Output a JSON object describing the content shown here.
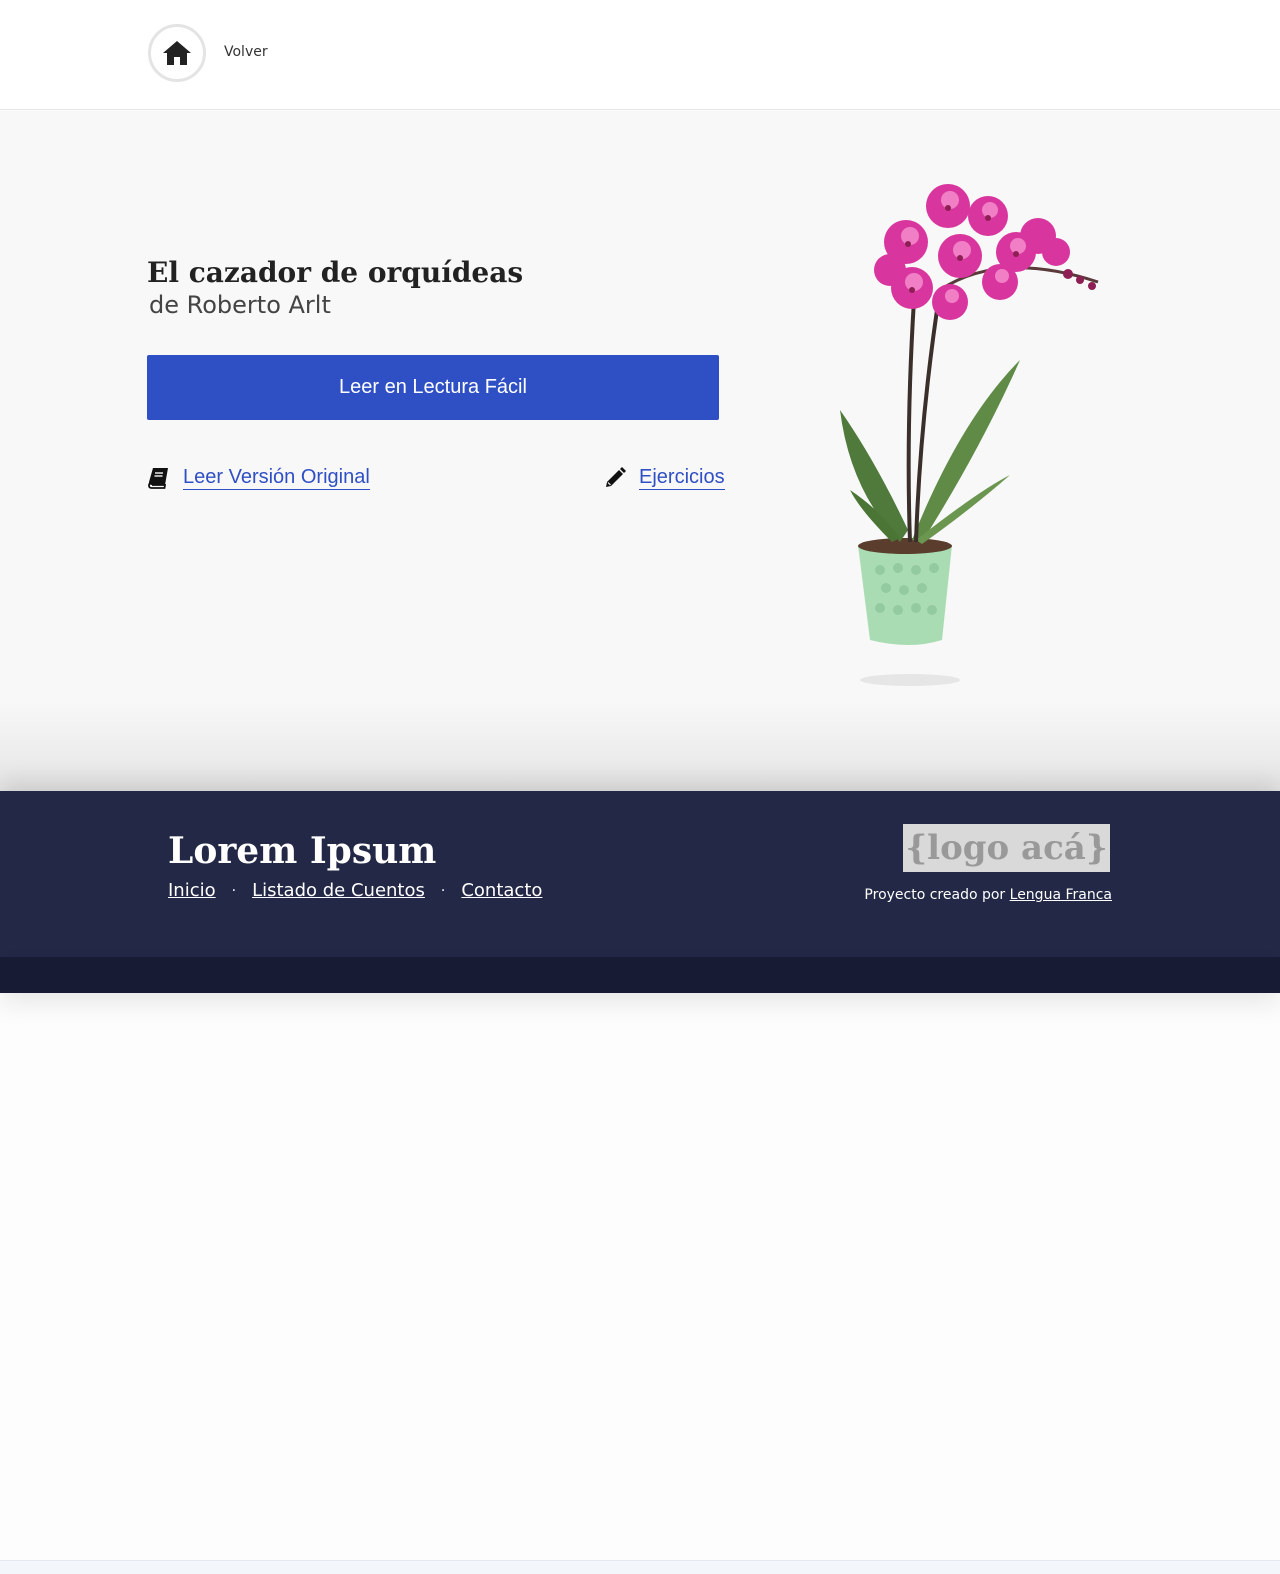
{
  "header": {
    "back_label": "Volver",
    "home_icon": "home-icon"
  },
  "story": {
    "title": "El cazador de orquídeas",
    "author": "de Roberto Arlt",
    "read_easy_label": "Leer en Lectura Fácil",
    "read_original_label": "Leer Versión Original",
    "exercises_label": "Ejercicios",
    "read_original_icon": "book-icon",
    "exercises_icon": "pencil-icon",
    "image": "orchid-plant-image"
  },
  "footer": {
    "brand": "Lorem Ipsum",
    "nav": [
      {
        "label": "Inicio"
      },
      {
        "label": "Listado de Cuentos"
      },
      {
        "label": "Contacto"
      }
    ],
    "separator": "·",
    "logo_placeholder": "{logo acá}",
    "credit_prefix": "Proyecto creado por",
    "credit_link": "Lengua Franca"
  },
  "colors": {
    "accent": "#2f4fc4",
    "footer_bg": "#222845",
    "footer_bottom": "#171b33",
    "hero_bg": "#f8f8f8",
    "orchid": "#d8369e",
    "pot": "#a9dcb2"
  }
}
